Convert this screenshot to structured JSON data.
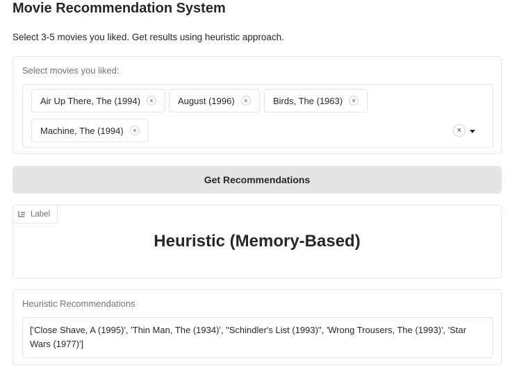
{
  "page": {
    "title": "Movie Recommendation System",
    "subtitle": "Select 3-5 movies you liked. Get results using heuristic approach."
  },
  "movie_select": {
    "label": "Select movies you liked:",
    "selected": [
      "Air Up There, The (1994)",
      "August (1996)",
      "Birds, The (1963)",
      "Machine, The (1994)"
    ],
    "remove_glyph": "×",
    "clear_glyph": "×"
  },
  "button": {
    "label": "Get Recommendations"
  },
  "label_output": {
    "tag": "Label",
    "value": "Heuristic (Memory-Based)"
  },
  "recommendations": {
    "label": "Heuristic Recommendations",
    "value": "['Close Shave, A (1995)', 'Thin Man, The (1934)', \"Schindler's List (1993)\", 'Wrong Trousers, The (1993)', 'Star Wars (1977)']"
  }
}
